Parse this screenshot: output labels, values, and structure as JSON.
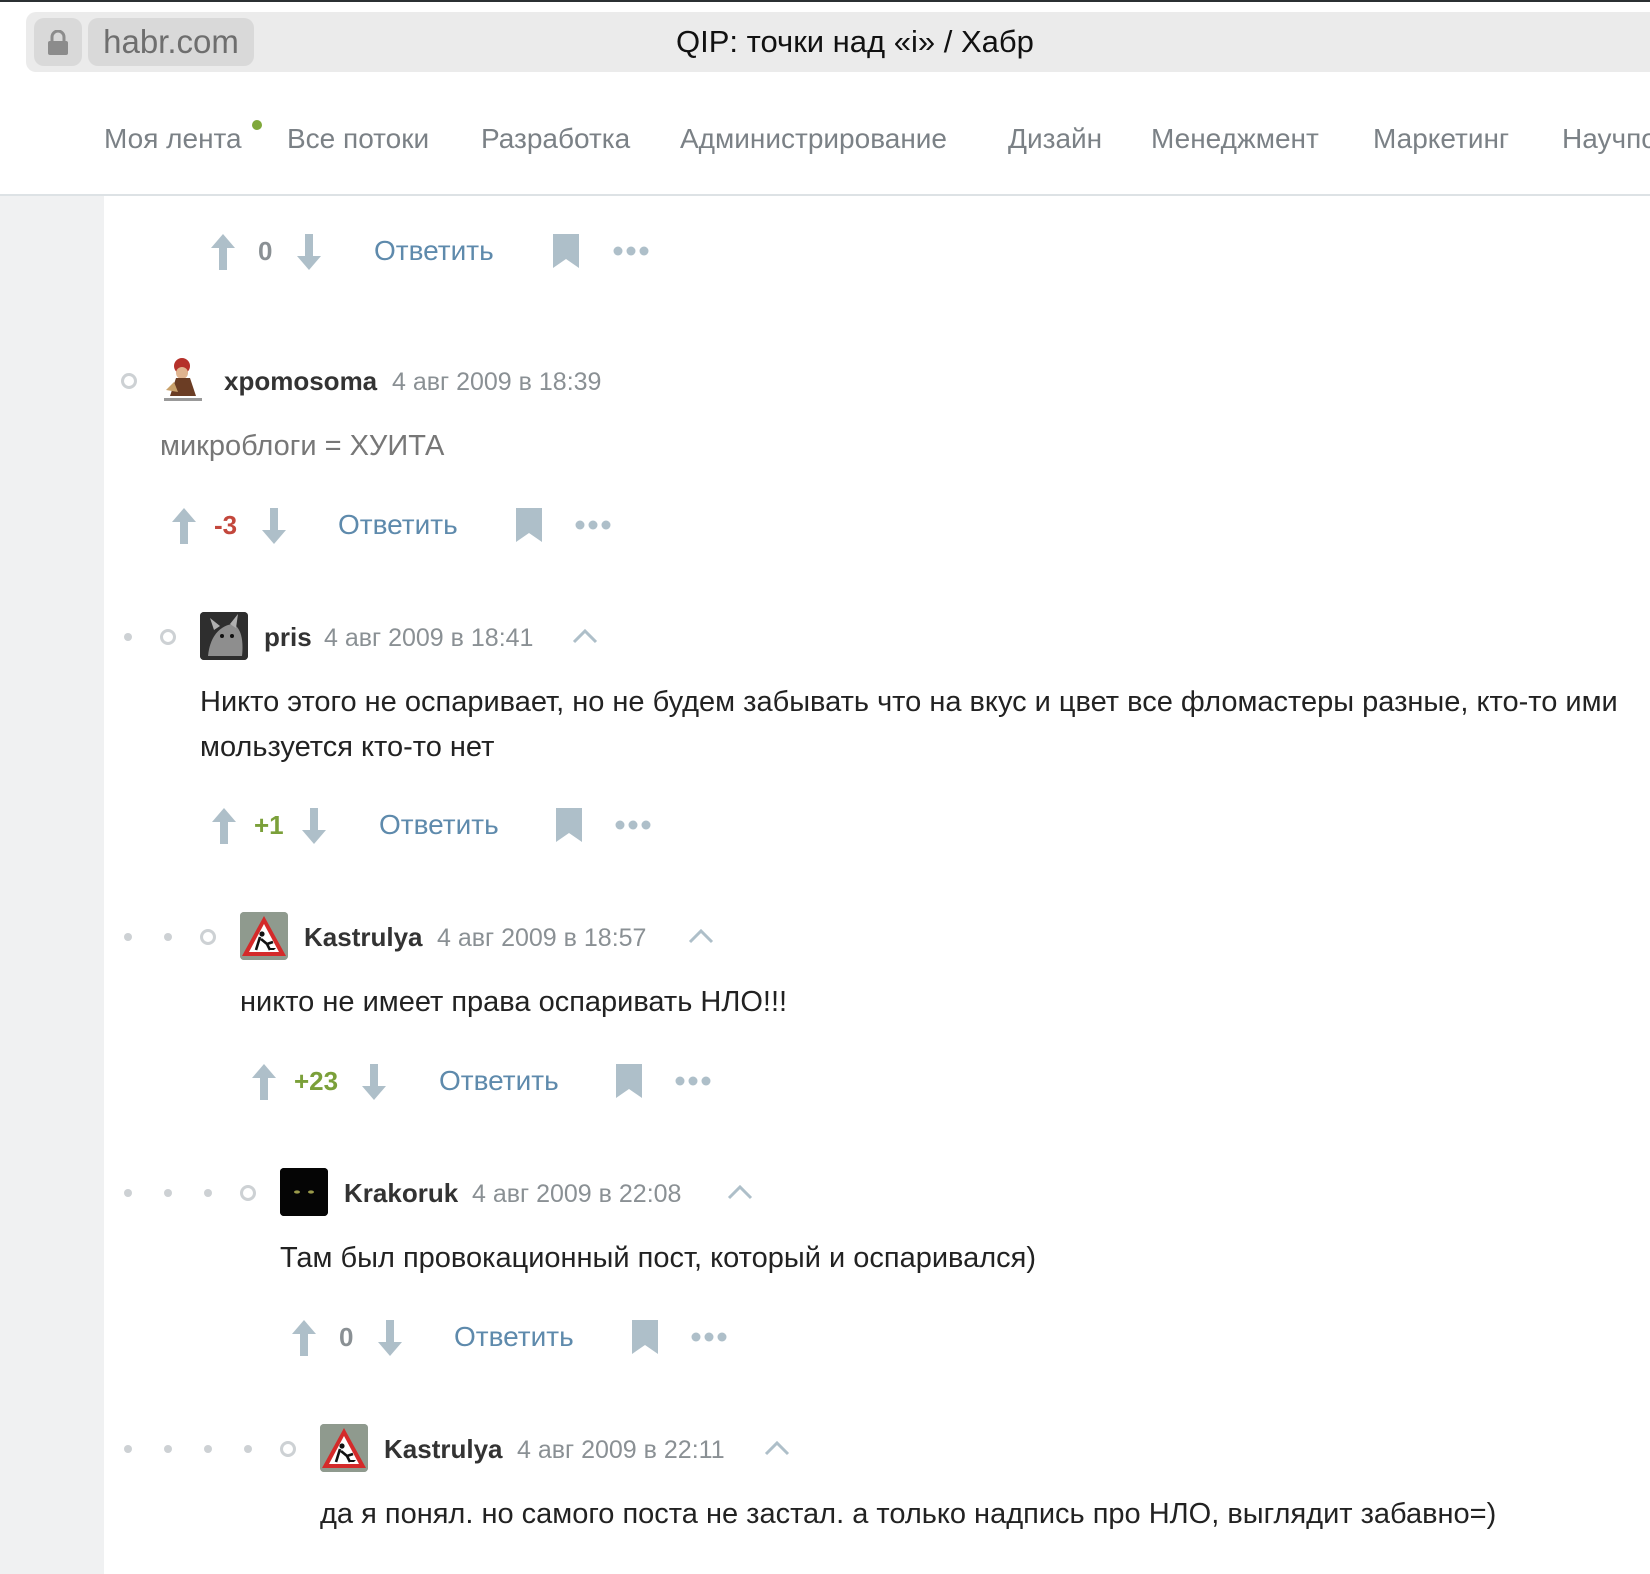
{
  "browser": {
    "domain": "habr.com",
    "page_title": "QIP: точки над «i» / Хабр"
  },
  "nav": {
    "items": [
      "Моя лента",
      "Все потоки",
      "Разработка",
      "Администрирование",
      "Дизайн",
      "Менеджмент",
      "Маркетинг",
      "Научпо"
    ],
    "unread_dot_color": "#7fa83a"
  },
  "top_actions": {
    "score": "0",
    "reply_label": "Ответить"
  },
  "comments": [
    {
      "username": "xpomosoma",
      "timestamp": "4 авг 2009 в 18:39",
      "text": "микроблоги = ХУИТА",
      "score": "-3",
      "reply_label": "Ответить",
      "level": 1
    },
    {
      "username": "pris",
      "timestamp": "4 авг 2009 в 18:41",
      "text": "Никто этого не оспаривает, но не будем забывать что на вкус и цвет все фломастеры разные, кто-то ими мользуется кто-то нет",
      "score": "+1",
      "reply_label": "Ответить",
      "level": 2
    },
    {
      "username": "Kastrulya",
      "timestamp": "4 авг 2009 в 18:57",
      "text": "никто не имеет права оспаривать НЛО!!!",
      "score": "+23",
      "reply_label": "Ответить",
      "level": 3
    },
    {
      "username": "Krakoruk",
      "timestamp": "4 авг 2009 в 22:08",
      "text": "Там был провокационный пост, который и оспаривался)",
      "score": "0",
      "reply_label": "Ответить",
      "level": 4
    },
    {
      "username": "Kastrulya",
      "timestamp": "4 авг 2009 в 22:11",
      "text": "да я понял. но самого поста не застал. а только надпись про НЛО, выглядит забавно=)",
      "level": 5
    }
  ],
  "colors": {
    "positive_score": "#7ba03a",
    "negative_score": "#c3473c",
    "link": "#5e8aac",
    "icon": "#aebfc9"
  }
}
